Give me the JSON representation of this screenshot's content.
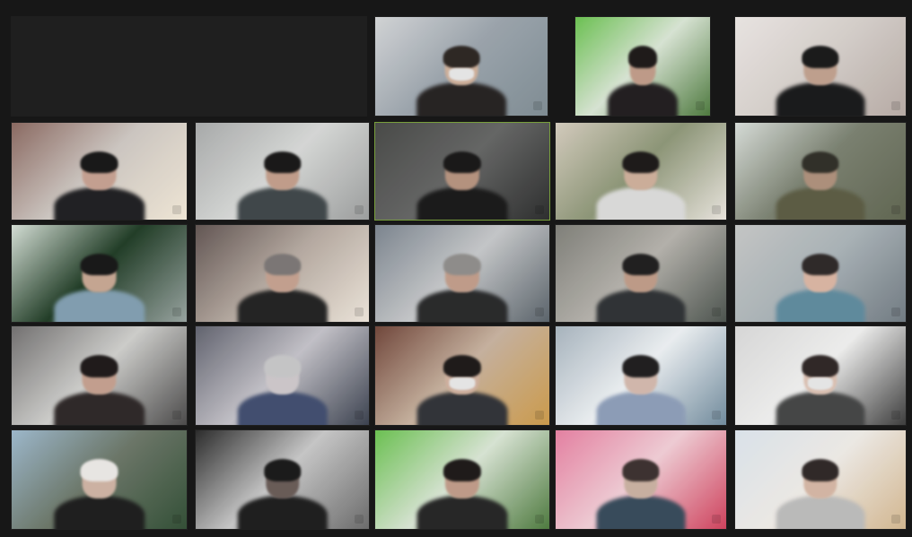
{
  "window": {
    "title": "",
    "background": "#171717"
  },
  "meeting": {
    "active_speaker_color": "#76a232"
  },
  "tiles": [
    {
      "name": "participant-tile-1",
      "palette": [
        "#d4d6d8",
        "#9aa4ad",
        "#7e8d95"
      ],
      "face": "#d2b098",
      "hair": "#2b2420",
      "body": "#24201f",
      "mask": true
    },
    {
      "name": "participant-tile-2",
      "palette": [
        "#65c548",
        "#d9e6d4",
        "#4a7b39"
      ],
      "face": "#c39b86",
      "hair": "#1b1716",
      "body": "#1f1b1d",
      "mask": false
    },
    {
      "name": "participant-tile-3",
      "palette": [
        "#ece7e4",
        "#d7d0cb",
        "#b9aca5"
      ],
      "face": "#c3a08c",
      "hair": "#171717",
      "body": "#161718",
      "mask": false
    },
    {
      "name": "participant-tile-4",
      "palette": [
        "#8d685f",
        "#cfc8c2",
        "#f3e9d6"
      ],
      "face": "#c9a08f",
      "hair": "#151515",
      "body": "#1d1d20",
      "mask": false
    },
    {
      "name": "participant-tile-5",
      "palette": [
        "#a9abab",
        "#d7d9d7",
        "#9d9f9f"
      ],
      "face": "#c59d88",
      "hair": "#161515",
      "body": "#3d4548",
      "mask": false
    },
    {
      "name": "participant-tile-6",
      "palette": [
        "#474846",
        "#646564",
        "#2b2c2c"
      ],
      "face": "#b9927c",
      "hair": "#161515",
      "body": "#171717",
      "mask": false
    },
    {
      "name": "participant-tile-7",
      "palette": [
        "#d6cdbd",
        "#8c9674",
        "#ebe6de"
      ],
      "face": "#d0ae98",
      "hair": "#1a1716",
      "body": "#dcdcdb",
      "mask": false
    },
    {
      "name": "participant-tile-8",
      "palette": [
        "#d8ded9",
        "#79806e",
        "#5f654e"
      ],
      "face": "#b08f79",
      "hair": "#2e2d25",
      "body": "#5b5b40",
      "mask": false
    },
    {
      "name": "participant-tile-9",
      "palette": [
        "#d6e1d7",
        "#1c3b22",
        "#97a4a0"
      ],
      "face": "#c9a690",
      "hair": "#151515",
      "body": "#7f9fb3",
      "mask": false
    },
    {
      "name": "participant-tile-10",
      "palette": [
        "#625451",
        "#b7aaa0",
        "#efe6da"
      ],
      "face": "#c7a08d",
      "hair": "#7b7674",
      "body": "#202020",
      "mask": false
    },
    {
      "name": "participant-tile-11",
      "palette": [
        "#7b8590",
        "#c6c8ca",
        "#59636b"
      ],
      "face": "#c49c87",
      "hair": "#8f8d8a",
      "body": "#262728",
      "mask": false
    },
    {
      "name": "participant-tile-12",
      "palette": [
        "#7f7f78",
        "#b5b2ab",
        "#4b534d"
      ],
      "face": "#c29b85",
      "hair": "#1d1c1c",
      "body": "#2d3033",
      "mask": false
    },
    {
      "name": "participant-tile-13",
      "palette": [
        "#c6c8c7",
        "#a9b3b8",
        "#707b83"
      ],
      "face": "#ddb5a0",
      "hair": "#2c2625",
      "body": "#5b8ba0",
      "mask": false
    },
    {
      "name": "participant-tile-14",
      "palette": [
        "#727070",
        "#cfcfcc",
        "#4a4949"
      ],
      "face": "#c79f8c",
      "hair": "#1c1717",
      "body": "#2c2525",
      "mask": false
    },
    {
      "name": "participant-tile-15",
      "palette": [
        "#60626f",
        "#c4c2c9",
        "#39404f"
      ],
      "face": "#cec8cb",
      "hair": "#c7c7c8",
      "body": "#3e4c71",
      "mask": false
    },
    {
      "name": "participant-tile-16",
      "palette": [
        "#734437",
        "#c9b29d",
        "#d29b42"
      ],
      "face": "#d3b09c",
      "hair": "#1b1716",
      "body": "#2f3136",
      "mask": true
    },
    {
      "name": "participant-tile-17",
      "palette": [
        "#a7b5c0",
        "#edf1f4",
        "#6f8ca0"
      ],
      "face": "#d5b8ab",
      "hair": "#1d1b1c",
      "body": "#8b9dbb",
      "mask": false
    },
    {
      "name": "participant-tile-18",
      "palette": [
        "#dadada",
        "#f0f0ef",
        "#3b3b3b"
      ],
      "face": "#dfc1b1",
      "hair": "#2d2423",
      "body": "#434444",
      "mask": true
    },
    {
      "name": "participant-tile-19",
      "palette": [
        "#9bb9cf",
        "#6a7666",
        "#2f4f33"
      ],
      "face": "#d1b3a2",
      "hair": "#ece9e6",
      "body": "#1b1b1b",
      "mask": false
    },
    {
      "name": "participant-tile-20",
      "palette": [
        "#292929",
        "#c8c8c8",
        "#6b6b6b"
      ],
      "face": "#695a55",
      "hair": "#171717",
      "body": "#1b1b1b",
      "mask": false
    },
    {
      "name": "participant-tile-21",
      "palette": [
        "#65c548",
        "#d9e6d4",
        "#4a7b39"
      ],
      "face": "#c39b86",
      "hair": "#1b1716",
      "body": "#232323",
      "mask": false
    },
    {
      "name": "participant-tile-22",
      "palette": [
        "#ee7ea3",
        "#f4cdd6",
        "#db3d5b"
      ],
      "face": "#ccb1a0",
      "hair": "#3b2f2d",
      "body": "#34495b",
      "mask": false
    },
    {
      "name": "participant-tile-23",
      "palette": [
        "#dce5ee",
        "#f0ece7",
        "#d7b88c"
      ],
      "face": "#d8b6a2",
      "hair": "#2d2524",
      "body": "#bcbcbb",
      "mask": false
    }
  ]
}
